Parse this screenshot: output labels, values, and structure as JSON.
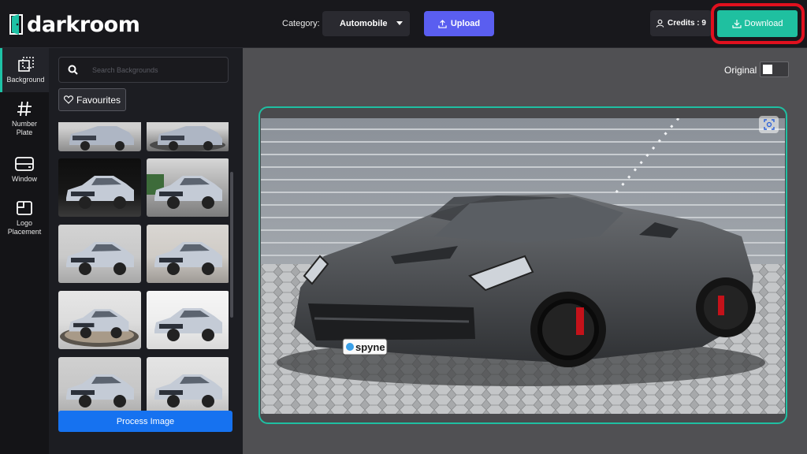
{
  "header": {
    "brand": "darkroom",
    "category_label": "Category:",
    "category_value": "Automobile",
    "upload_label": "Upload",
    "credits_label": "Credits : 9",
    "download_label": "Download"
  },
  "rail": {
    "items": [
      {
        "label": "Background",
        "icon": "background-icon"
      },
      {
        "label": "Number Plate",
        "icon": "hash-icon"
      },
      {
        "label": "Window",
        "icon": "window-icon"
      },
      {
        "label": "Logo Placement",
        "icon": "logo-placement-icon"
      }
    ]
  },
  "panel": {
    "search_placeholder": "Search Backgrounds",
    "favourites_label": "Favourites",
    "process_label": "Process Image"
  },
  "canvas": {
    "original_label": "Original",
    "plate_text": "spyne"
  },
  "colors": {
    "accent": "#1fc0a0",
    "upload": "#5a5ef0",
    "process": "#1672f0",
    "highlight": "#e0101e"
  }
}
